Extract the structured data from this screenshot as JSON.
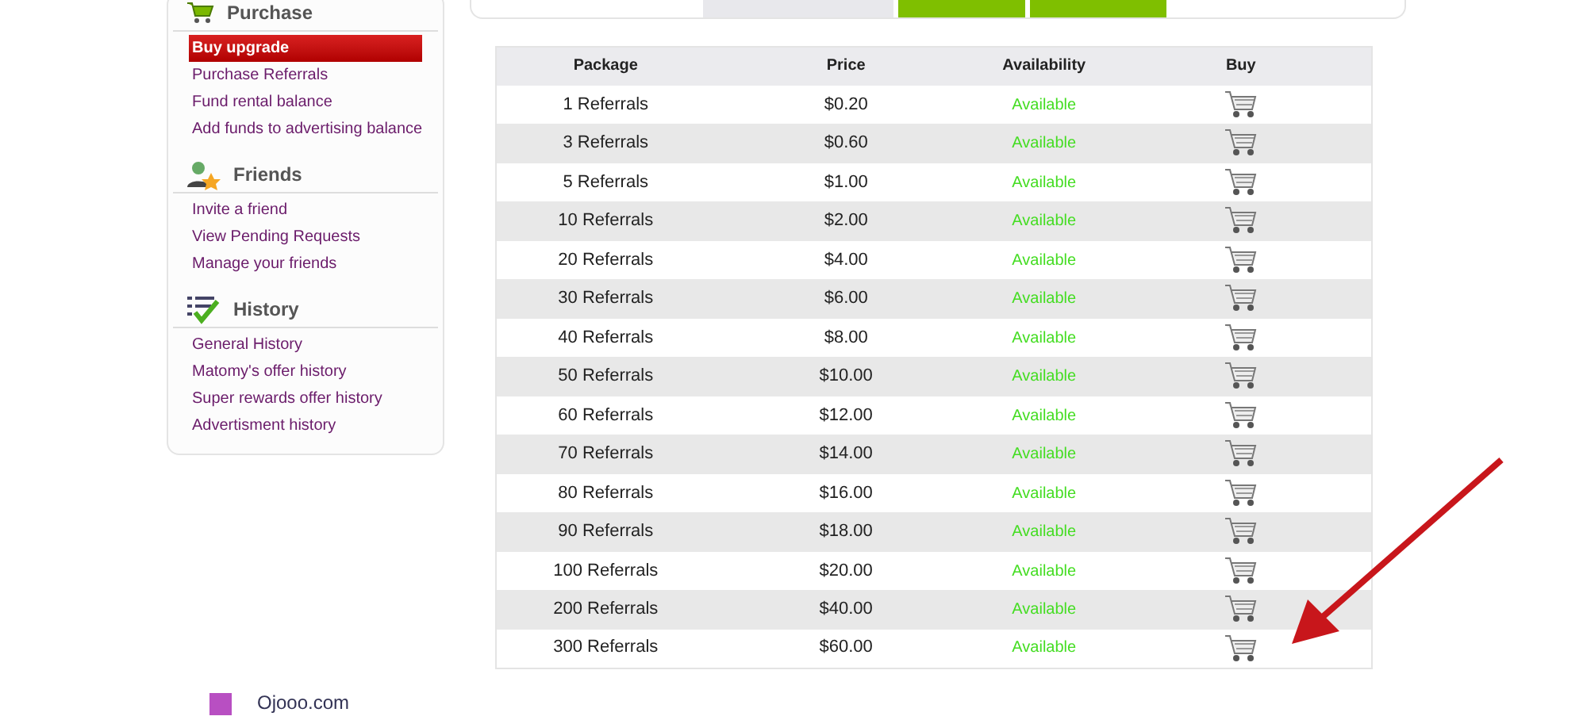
{
  "sidebar": {
    "sections": [
      {
        "title": "Purchase",
        "kind": "cart",
        "items": [
          {
            "label": "Buy upgrade",
            "selected": true
          },
          {
            "label": "Purchase Referrals",
            "selected": false
          },
          {
            "label": "Fund rental balance",
            "selected": false
          },
          {
            "label": "Add funds to advertising balance",
            "selected": false
          }
        ]
      },
      {
        "title": "Friends",
        "kind": "friends",
        "items": [
          {
            "label": "Invite a friend",
            "selected": false
          },
          {
            "label": "View Pending Requests",
            "selected": false
          },
          {
            "label": "Manage your friends",
            "selected": false
          }
        ]
      },
      {
        "title": "History",
        "kind": "history",
        "items": [
          {
            "label": "General History",
            "selected": false
          },
          {
            "label": "Matomy's offer history",
            "selected": false
          },
          {
            "label": "Super rewards offer history",
            "selected": false
          },
          {
            "label": "Advertisment history",
            "selected": false
          }
        ]
      }
    ]
  },
  "table": {
    "columns": [
      "Package",
      "Price",
      "Availability",
      "Buy"
    ],
    "rows": [
      {
        "package": "1 Referrals",
        "price": "$0.20",
        "availability": "Available"
      },
      {
        "package": "3 Referrals",
        "price": "$0.60",
        "availability": "Available"
      },
      {
        "package": "5 Referrals",
        "price": "$1.00",
        "availability": "Available"
      },
      {
        "package": "10 Referrals",
        "price": "$2.00",
        "availability": "Available"
      },
      {
        "package": "20 Referrals",
        "price": "$4.00",
        "availability": "Available"
      },
      {
        "package": "30 Referrals",
        "price": "$6.00",
        "availability": "Available"
      },
      {
        "package": "40 Referrals",
        "price": "$8.00",
        "availability": "Available"
      },
      {
        "package": "50 Referrals",
        "price": "$10.00",
        "availability": "Available"
      },
      {
        "package": "60 Referrals",
        "price": "$12.00",
        "availability": "Available"
      },
      {
        "package": "70 Referrals",
        "price": "$14.00",
        "availability": "Available"
      },
      {
        "package": "80 Referrals",
        "price": "$16.00",
        "availability": "Available"
      },
      {
        "package": "90 Referrals",
        "price": "$18.00",
        "availability": "Available"
      },
      {
        "package": "100 Referrals",
        "price": "$20.00",
        "availability": "Available"
      },
      {
        "package": "200 Referrals",
        "price": "$40.00",
        "availability": "Available"
      },
      {
        "package": "300 Referrals",
        "price": "$60.00",
        "availability": "Available"
      }
    ]
  },
  "footer_link": "Ojooo.com"
}
